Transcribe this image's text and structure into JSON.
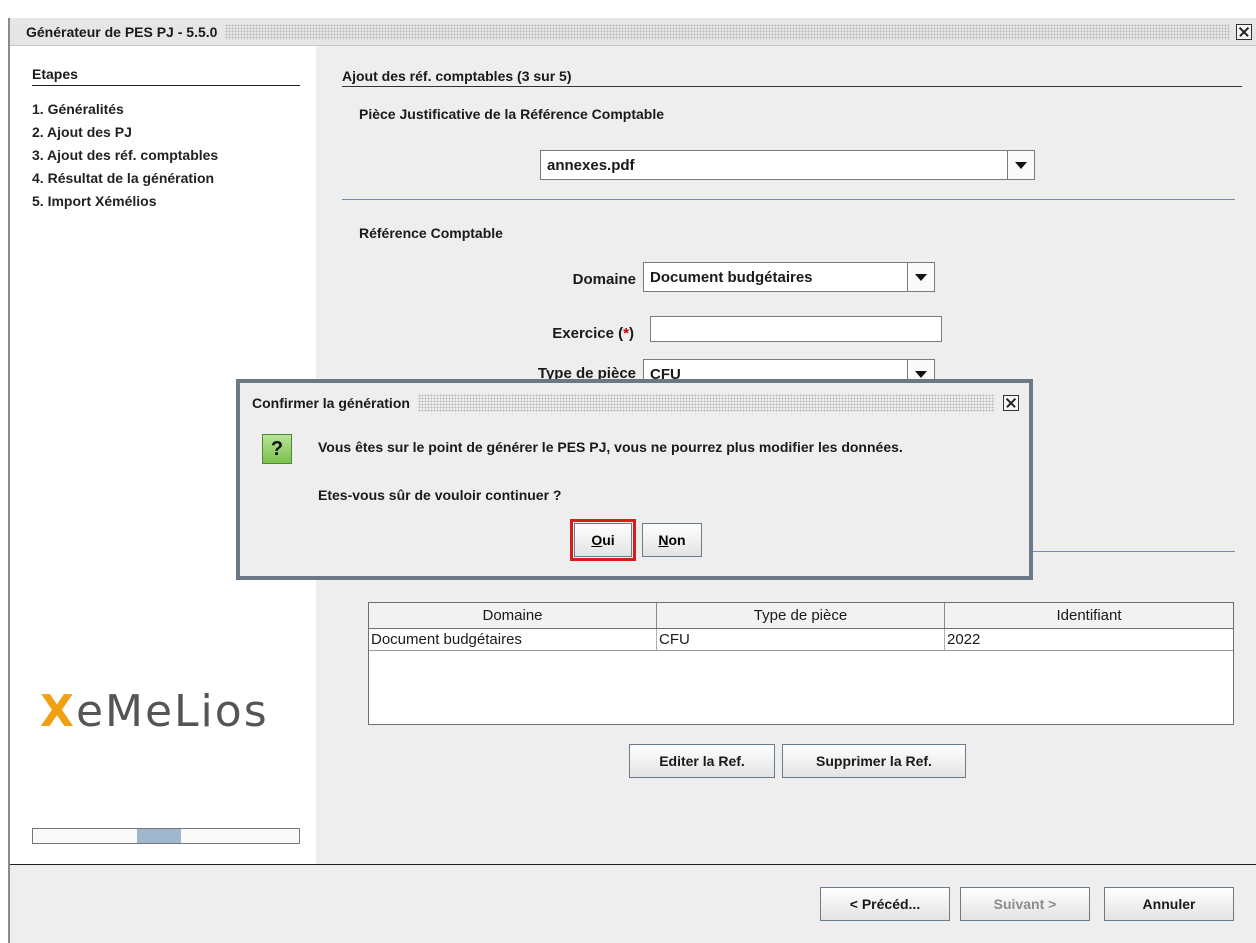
{
  "window": {
    "title": "Générateur de PES PJ - 5.5.0"
  },
  "steps": {
    "title": "Etapes",
    "items": [
      {
        "num": "1.",
        "label": " Généralités"
      },
      {
        "num": "2.",
        "label": " Ajout des PJ"
      },
      {
        "num": "3.",
        "label": " Ajout des réf. comptables"
      },
      {
        "num": "4.",
        "label": " Résultat de la génération"
      },
      {
        "num": "5.",
        "label": " Import Xémélios"
      }
    ]
  },
  "logo": {
    "text": "XeMeLios",
    "accent": "#f0a010"
  },
  "main": {
    "section_title": "Ajout des réf. comptables (3 sur 5)",
    "piece_title": "Pièce Justificative de la Référence Comptable",
    "piece_value": "annexes.pdf",
    "ref_title": "Référence Comptable",
    "domaine_label": "Domaine",
    "domaine_value": "Document budgétaires",
    "exercice_label": "Exercice (",
    "exercice_req": "*",
    "exercice_label_end": ")",
    "exercice_value": "",
    "type_label": "Type de pièce",
    "type_value": "CFU",
    "table": {
      "headers": [
        "Domaine",
        "Type de pièce",
        "Identifiant"
      ],
      "rows": [
        [
          "Document budgétaires",
          "CFU",
          "2022"
        ]
      ]
    },
    "edit_button": "Editer la Ref.",
    "delete_button": "Supprimer la Ref."
  },
  "footer": {
    "prev_button": "< Précéd...",
    "next_button": "Suivant >",
    "cancel_button": "Annuler"
  },
  "dialog": {
    "title": "Confirmer la génération",
    "icon": "?",
    "message1": "Vous êtes sur le point de générer le PES PJ, vous ne pourrez plus modifier les données.",
    "message2": "Etes-vous sûr de vouloir continuer ?",
    "yes_mnemonic": "O",
    "yes_rest": "ui",
    "no_mnemonic": "N",
    "no_rest": "on"
  }
}
